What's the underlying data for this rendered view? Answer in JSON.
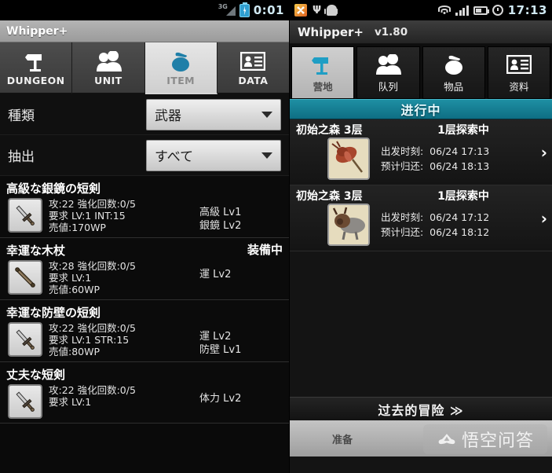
{
  "left_phone": {
    "statusbar": {
      "network": "3G",
      "time": "0:01",
      "battery_icon": "battery-charging-icon",
      "signal_icon": "signal-3g-icon"
    },
    "title": "Whipper+",
    "tabs": [
      {
        "label": "DUNGEON",
        "icon": "signpost-icon",
        "selected": false
      },
      {
        "label": "UNIT",
        "icon": "people-icon",
        "selected": false
      },
      {
        "label": "ITEM",
        "icon": "pouch-icon",
        "selected": true
      },
      {
        "label": "DATA",
        "icon": "id-card-icon",
        "selected": false
      }
    ],
    "filters": [
      {
        "label": "種類",
        "value": "武器"
      },
      {
        "label": "抽出",
        "value": "すべて"
      }
    ],
    "items": [
      {
        "name": "高級な銀鏡の短剣",
        "badge": "",
        "icon": "dagger-icon",
        "stats": [
          "攻:22 強化回数:0/5",
          "要求 LV:1 INT:15",
          "売値:170WP"
        ],
        "affixes": [
          "高級 Lv1",
          "銀鏡 Lv2"
        ]
      },
      {
        "name": "幸運な木杖",
        "badge": "装備中",
        "icon": "staff-icon",
        "stats": [
          "攻:28 強化回数:0/5",
          "要求 LV:1",
          "売値:60WP"
        ],
        "affixes": [
          "運 Lv2"
        ]
      },
      {
        "name": "幸運な防壁の短剣",
        "badge": "",
        "icon": "dagger-icon",
        "stats": [
          "攻:22 強化回数:0/5",
          "要求 LV:1 STR:15",
          "売値:80WP"
        ],
        "affixes": [
          "運 Lv2",
          "防壁 Lv1"
        ]
      },
      {
        "name": "丈夫な短剣",
        "badge": "",
        "icon": "dagger-icon",
        "stats": [
          "攻:22 強化回数:0/5",
          "要求 LV:1"
        ],
        "affixes": [
          "体力 Lv2"
        ]
      }
    ]
  },
  "right_phone": {
    "statusbar": {
      "time": "17:13",
      "icons": [
        "app-icon",
        "usb-icon",
        "android-icon",
        "wifi-icon",
        "signal-bars-icon",
        "battery-icon",
        "alarm-clock-icon"
      ]
    },
    "title": "Whipper+",
    "version": "v1.80",
    "tabs": [
      {
        "label": "营地",
        "icon": "signpost-icon",
        "selected": true
      },
      {
        "label": "队列",
        "icon": "people-icon",
        "selected": false
      },
      {
        "label": "物品",
        "icon": "pouch-icon",
        "selected": false
      },
      {
        "label": "资料",
        "icon": "id-card-icon",
        "selected": false
      }
    ],
    "section_title": "进行中",
    "quests": [
      {
        "name": "初始之森 3层",
        "state": "1层探索中",
        "icon": "beetle-monster-icon",
        "depart_label": "出发时刻:",
        "depart_value": "06/24 17:13",
        "return_label": "预计归还:",
        "return_value": "06/24 18:13",
        "chevron": "›"
      },
      {
        "name": "初始之森 3层",
        "state": "1层探索中",
        "icon": "beast-monster-icon",
        "depart_label": "出发时刻:",
        "depart_value": "06/24 17:12",
        "return_label": "预计归还:",
        "return_value": "06/24 18:12",
        "chevron": "›"
      }
    ],
    "past_adventures": "过去的冒险 ≫",
    "prepare_button": "准备",
    "watermark": {
      "text": "悟空问答",
      "logo": "wukong-cloud-icon"
    }
  },
  "colors": {
    "accent_blue": "#1f7fa8",
    "teal_header": "#127a8f",
    "selected_tab_bg": "#d8d8d8",
    "panel_dark": "#141414"
  }
}
